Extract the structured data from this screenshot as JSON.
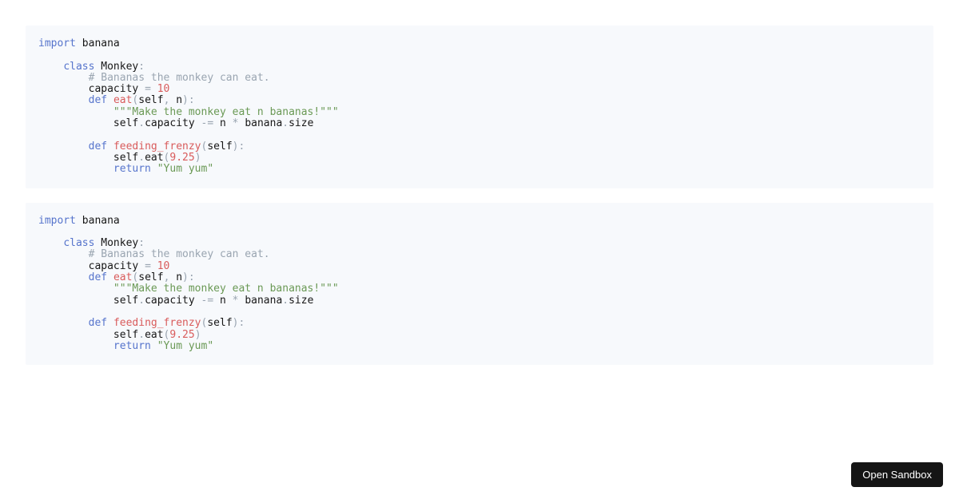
{
  "code": {
    "tokens": [
      {
        "c": "kw",
        "t": "import"
      },
      {
        "t": " "
      },
      {
        "c": "name",
        "t": "banana"
      },
      {
        "t": "\n"
      },
      {
        "t": "\n"
      },
      {
        "t": "    "
      },
      {
        "c": "kw",
        "t": "class"
      },
      {
        "t": " "
      },
      {
        "c": "name",
        "t": "Monkey"
      },
      {
        "c": "punc",
        "t": ":"
      },
      {
        "t": "\n"
      },
      {
        "t": "        "
      },
      {
        "c": "com",
        "t": "# Bananas the monkey can eat."
      },
      {
        "t": "\n"
      },
      {
        "t": "        "
      },
      {
        "c": "name",
        "t": "capacity"
      },
      {
        "t": " "
      },
      {
        "c": "punc",
        "t": "="
      },
      {
        "t": " "
      },
      {
        "c": "num",
        "t": "10"
      },
      {
        "t": "\n"
      },
      {
        "t": "        "
      },
      {
        "c": "kw",
        "t": "def"
      },
      {
        "t": " "
      },
      {
        "c": "fn",
        "t": "eat"
      },
      {
        "c": "punc",
        "t": "("
      },
      {
        "c": "name",
        "t": "self"
      },
      {
        "c": "punc",
        "t": ","
      },
      {
        "t": " "
      },
      {
        "c": "name",
        "t": "n"
      },
      {
        "c": "punc",
        "t": ")"
      },
      {
        "c": "punc",
        "t": ":"
      },
      {
        "t": "\n"
      },
      {
        "t": "            "
      },
      {
        "c": "str",
        "t": "\"\"\"Make the monkey eat n bananas!\"\"\""
      },
      {
        "t": "\n"
      },
      {
        "t": "            "
      },
      {
        "c": "name",
        "t": "self"
      },
      {
        "c": "punc",
        "t": "."
      },
      {
        "c": "name",
        "t": "capacity"
      },
      {
        "t": " "
      },
      {
        "c": "punc",
        "t": "-="
      },
      {
        "t": " "
      },
      {
        "c": "name",
        "t": "n"
      },
      {
        "t": " "
      },
      {
        "c": "punc",
        "t": "*"
      },
      {
        "t": " "
      },
      {
        "c": "name",
        "t": "banana"
      },
      {
        "c": "punc",
        "t": "."
      },
      {
        "c": "name",
        "t": "size"
      },
      {
        "t": "\n"
      },
      {
        "t": "\n"
      },
      {
        "t": "        "
      },
      {
        "c": "kw",
        "t": "def"
      },
      {
        "t": " "
      },
      {
        "c": "fn",
        "t": "feeding_frenzy"
      },
      {
        "c": "punc",
        "t": "("
      },
      {
        "c": "name",
        "t": "self"
      },
      {
        "c": "punc",
        "t": ")"
      },
      {
        "c": "punc",
        "t": ":"
      },
      {
        "t": "\n"
      },
      {
        "t": "            "
      },
      {
        "c": "name",
        "t": "self"
      },
      {
        "c": "punc",
        "t": "."
      },
      {
        "c": "name",
        "t": "eat"
      },
      {
        "c": "punc",
        "t": "("
      },
      {
        "c": "num",
        "t": "9.25"
      },
      {
        "c": "punc",
        "t": ")"
      },
      {
        "t": "\n"
      },
      {
        "t": "            "
      },
      {
        "c": "kw",
        "t": "return"
      },
      {
        "t": " "
      },
      {
        "c": "str",
        "t": "\"Yum yum\""
      }
    ]
  },
  "button": {
    "label": "Open Sandbox"
  }
}
